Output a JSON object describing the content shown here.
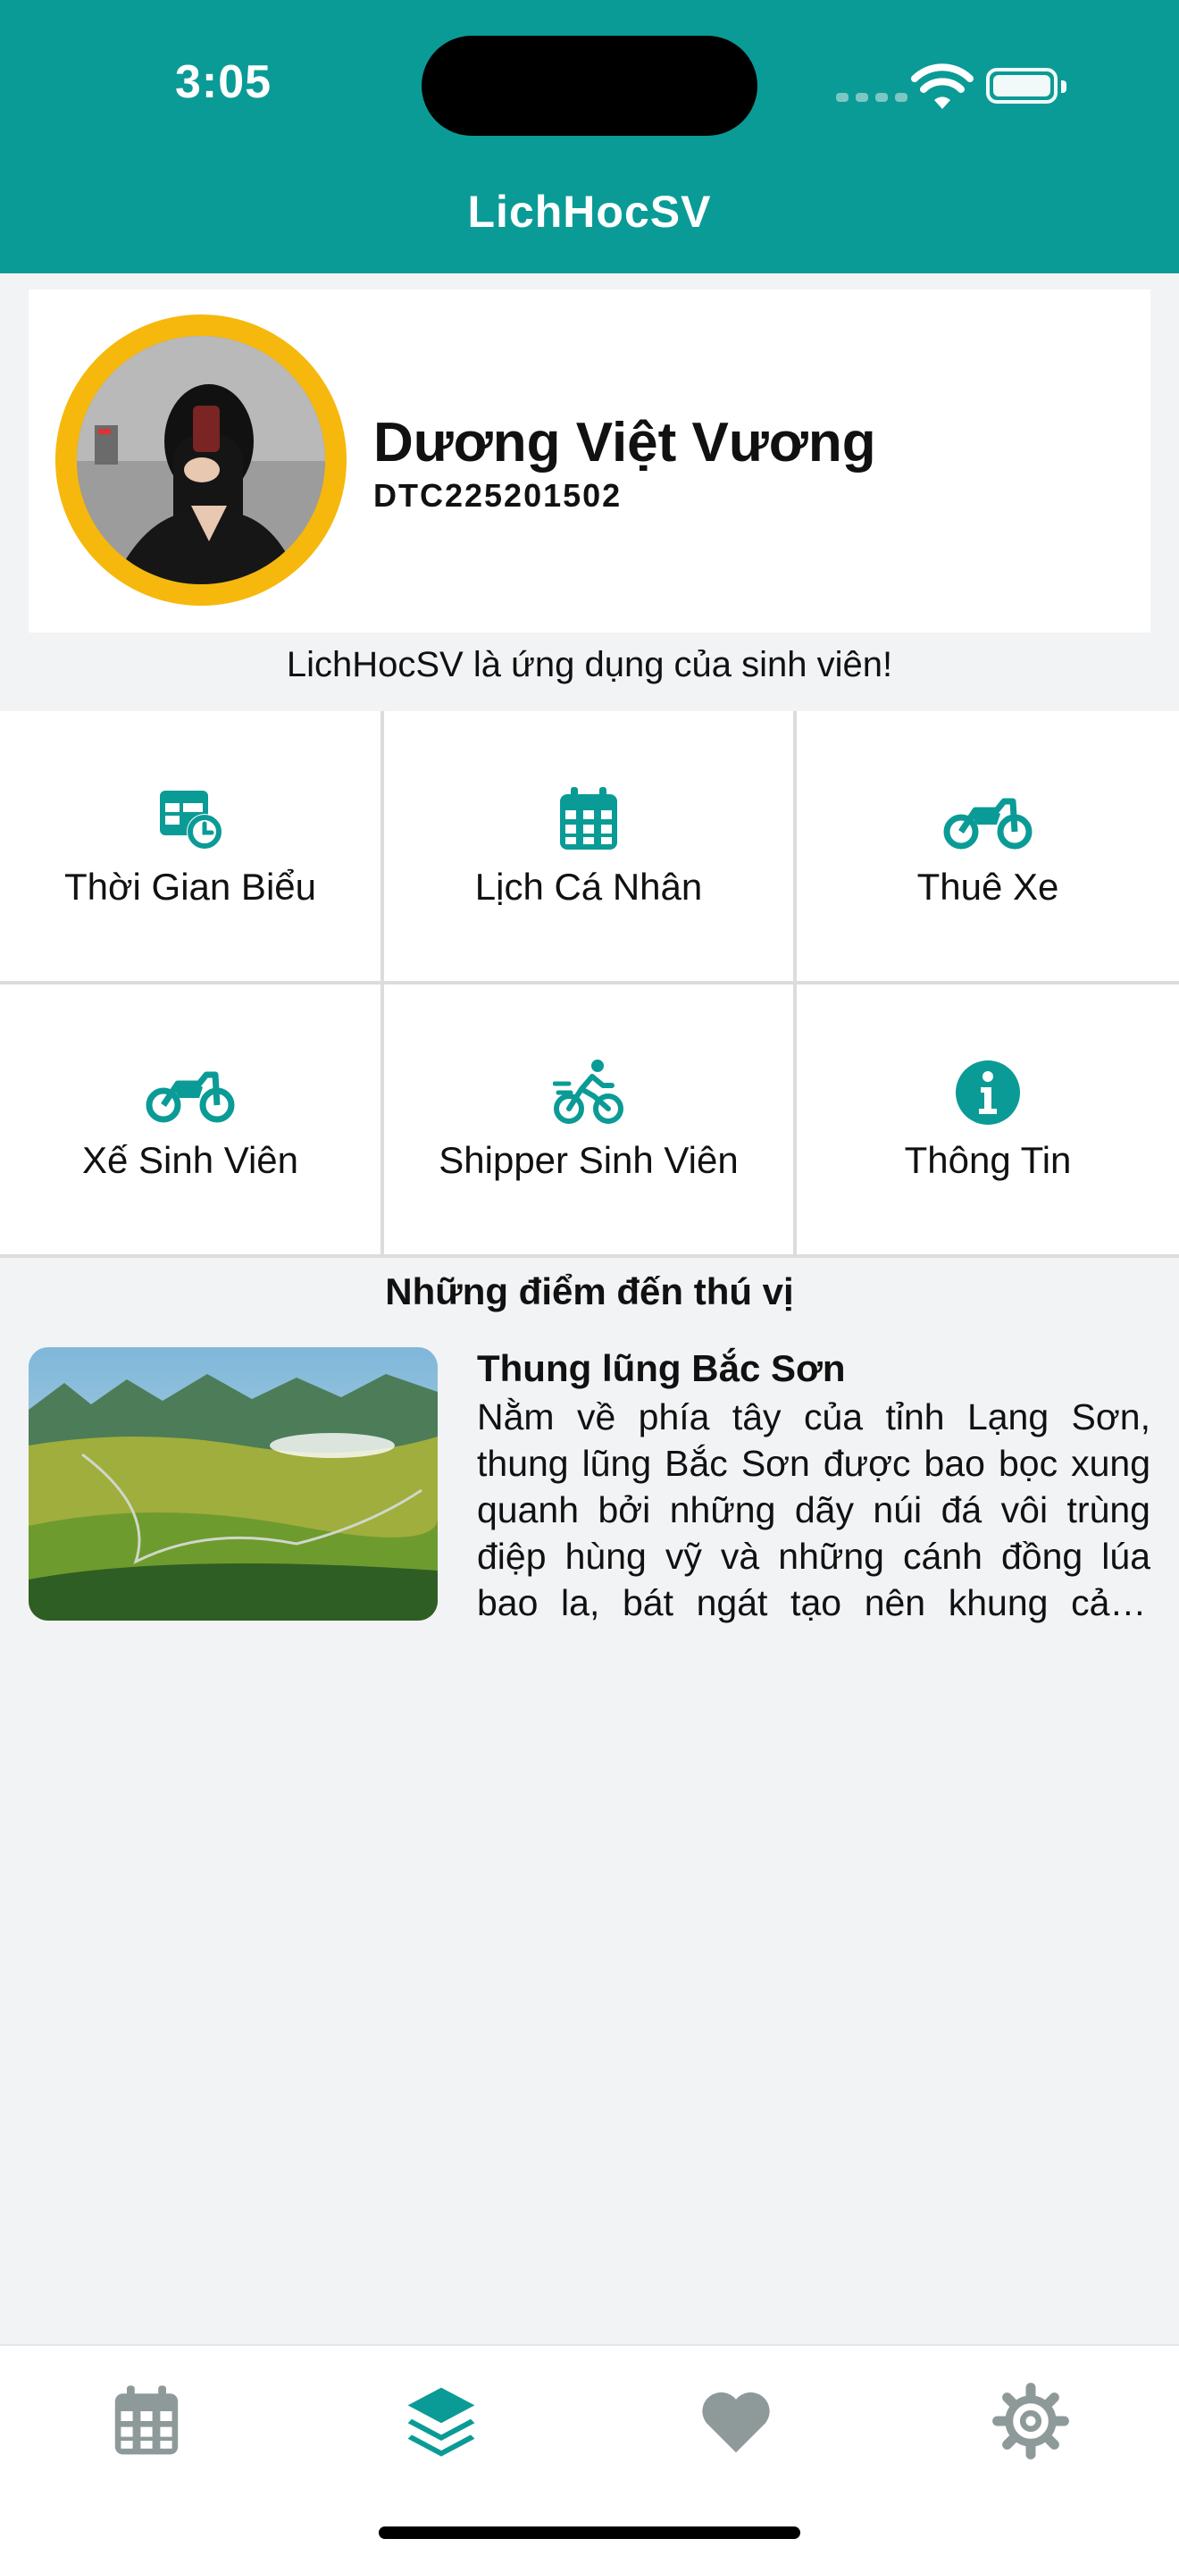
{
  "status": {
    "time": "3:05"
  },
  "header": {
    "title": "LichHocSV"
  },
  "profile": {
    "name": "Dương Việt Vương",
    "student_id": "DTC225201502"
  },
  "tagline": "LichHocSV là ứng dụng của sinh viên!",
  "menu": [
    {
      "label": "Thời Gian Biểu",
      "icon": "timetable-icon"
    },
    {
      "label": "Lịch Cá Nhân",
      "icon": "calendar-icon"
    },
    {
      "label": "Thuê Xe",
      "icon": "motorcycle-icon"
    },
    {
      "label": "Xế Sinh Viên",
      "icon": "motorcycle-icon"
    },
    {
      "label": "Shipper Sinh Viên",
      "icon": "bicycle-rider-icon"
    },
    {
      "label": "Thông Tin",
      "icon": "info-icon"
    }
  ],
  "destinations": {
    "section_title": "Những điểm đến thú vị",
    "items": [
      {
        "title": "Thung lũng Bắc Sơn",
        "description": "Nằm về phía tây của tỉnh Lạng Sơn, thung lũng Bắc Sơn được bao bọc xung quanh bởi những dãy núi đá vôi trùng điệp hùng vỹ và những cánh đồng lúa bao la, bát ngát tạo nên khung cảnh tuyệt đẹp."
      }
    ]
  },
  "tabbar": {
    "items": [
      {
        "icon": "calendar-icon",
        "active": false
      },
      {
        "icon": "layers-icon",
        "active": true
      },
      {
        "icon": "heart-icon",
        "active": false
      },
      {
        "icon": "gear-icon",
        "active": false
      }
    ]
  },
  "colors": {
    "primary": "#0b9b96",
    "accent_ring": "#f6b80c",
    "inactive_icon": "#8e9a9a",
    "background": "#f2f3f5"
  }
}
